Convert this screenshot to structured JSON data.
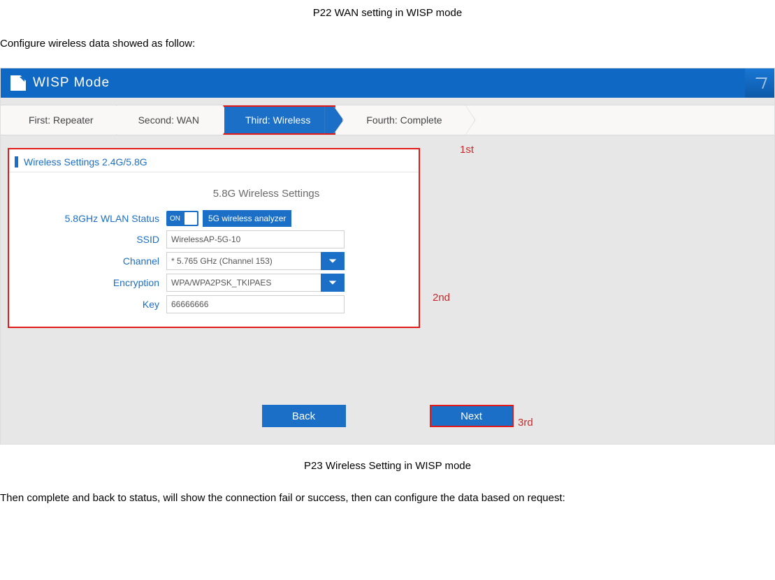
{
  "doc": {
    "caption_top": "P22 WAN setting in WISP mode",
    "intro": "Configure wireless data showed as follow:",
    "caption_bottom": "P23 Wireless Setting in WISP mode",
    "outro": "Then complete and back to status, will show the connection fail or success, then can configure the data based on request:"
  },
  "titlebar": {
    "title": "WISP Mode"
  },
  "wizard": {
    "step1": "First: Repeater",
    "step2": "Second: WAN",
    "step3": "Third: Wireless",
    "step4": "Fourth: Complete"
  },
  "annotations": {
    "a1": "1st",
    "a2": "2nd",
    "a3": "3rd"
  },
  "panel": {
    "title": "Wireless Settings 2.4G/5.8G",
    "sub_heading": "5.8G Wireless Settings",
    "labels": {
      "wlan_status": "5.8GHz WLAN Status",
      "analyzer_btn": "5G wireless analyzer",
      "switch_text": "ON",
      "ssid": "SSID",
      "channel": "Channel",
      "encryption": "Encryption",
      "key": "Key"
    },
    "values": {
      "ssid": "WirelessAP-5G-10",
      "channel": "* 5.765 GHz (Channel 153)",
      "encryption": "WPA/WPA2PSK_TKIPAES",
      "key": "66666666"
    }
  },
  "buttons": {
    "back": "Back",
    "next": "Next"
  }
}
